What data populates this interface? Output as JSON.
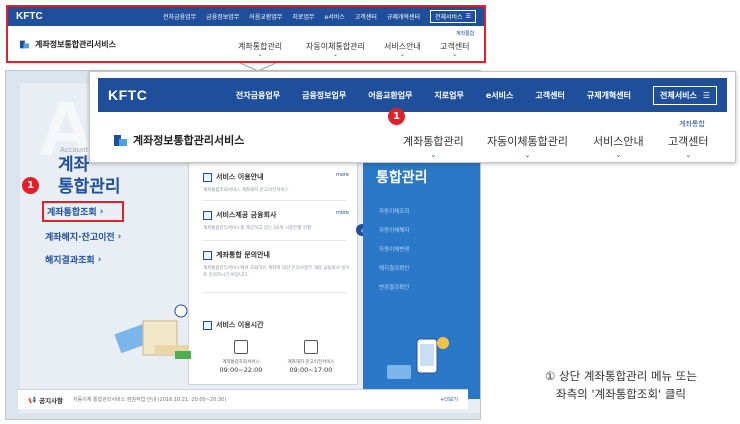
{
  "mini_header": {
    "logo": "KFTC",
    "nav": [
      "전자금융업무",
      "금융정보업무",
      "어음교환업무",
      "지로업무",
      "e서비스",
      "고객센터",
      "규제개혁센터"
    ],
    "all_services": "전체서비스",
    "brand": "계좌정보통합관리서비스",
    "menus": [
      "계좌통합관리",
      "자동이체통합관리",
      "서비스안내",
      "고객센터"
    ],
    "cs_top": "계좌통합"
  },
  "zoom_header": {
    "logo": "KFTC",
    "nav": [
      "전자금융업무",
      "금융정보업무",
      "어음교환업무",
      "지로업무",
      "e서비스",
      "고객센터",
      "규제개혁센터"
    ],
    "all_services": "전체서비스",
    "brand": "계좌정보통합관리서비스",
    "menus": [
      "계좌통합관리",
      "자동이체통합관리",
      "서비스안내",
      "고객센터"
    ],
    "cs_top": "계좌통합",
    "badge": "1"
  },
  "page": {
    "watermark": "AC",
    "side_en": "AccountInfo",
    "side_title_1": "계좌",
    "side_title_2": "통합관리",
    "side_badge": "1",
    "side_items": [
      "계좌통합조회",
      "계좌해지·잔고이전",
      "해지결과조회"
    ],
    "dropdown": [
      {
        "title": "서비스 이용안내",
        "desc": "계좌통합조회서비스    계좌해지·잔고이전서비스",
        "more": "more"
      },
      {
        "title": "서비스제공 금융회사",
        "desc": "계좌통합관리서비스를 제공하고 있는 16개 시중은행 현황",
        "more": "more"
      },
      {
        "title": "계좌통합 문의안내",
        "desc": "계좌통합관리서비스에서 조회하신 계좌에 대한 문의사항은 해당 금융회사 앞으로 문의하시기 바랍니다.",
        "more": ""
      }
    ],
    "time_title": "서비스 이용시간",
    "times": [
      {
        "label": "계좌통합조회서비스",
        "value": "09:00~22:00"
      },
      {
        "label": "계좌해지·잔고이전서비스",
        "value": "09:00~17:00"
      }
    ],
    "panel_title": "통합관리",
    "panel_items": [
      "자동이체조회",
      "자동이체해지",
      "자동이체변경",
      "해지결과확인",
      "변경결과확인"
    ],
    "notice_label": "공지사항",
    "notice_text": "자동이체 통합관리서비스 점검작업 안내 (2016.10.21. 20:00~20:30)",
    "notice_more": "+더보기"
  },
  "caption": {
    "line1": "① 상단 계좌통합관리 메뉴 또는",
    "line2": "좌측의 '계좌통합조회' 클릭"
  },
  "colors": {
    "brand_blue": "#1f4f9b",
    "highlight_red": "#e31f2a",
    "panel_blue": "#2a78c7"
  }
}
